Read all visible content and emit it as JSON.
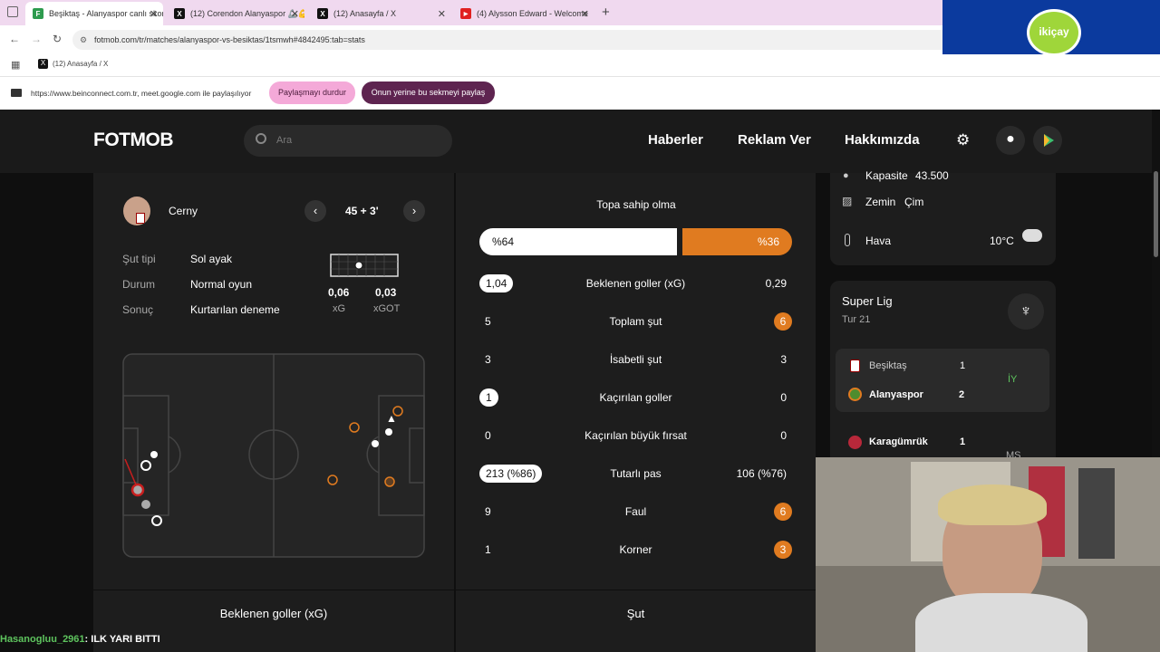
{
  "browser": {
    "tabs": [
      {
        "title": "Beşiktaş - Alanyaspor canlı skor",
        "fav": "F",
        "color": "#2d9b4e"
      },
      {
        "title": "(12) Corendon Alanyaspor 🦾💪",
        "fav": "X",
        "color": "#111"
      },
      {
        "title": "(12) Anasayfa / X",
        "fav": "X",
        "color": "#111"
      },
      {
        "title": "(4) Alysson Edward - Welcome",
        "fav": "▶",
        "color": "#e02020"
      }
    ],
    "url": "fotmob.com/tr/matches/alanyaspor-vs-besiktas/1tsmwh#4842495:tab=stats",
    "bookmark": "(12) Anasayfa / X",
    "share_text": "https://www.beinconnect.com.tr, meet.google.com ile paylaşılıyor",
    "stop_share": "Paylaşmayı durdur",
    "share_tab": "Onun yerine bu sekmeyi paylaş",
    "ad_logo": "ikiçay"
  },
  "header": {
    "logo": "FOTMOB",
    "search_placeholder": "Ara",
    "nav": [
      "Haberler",
      "Reklam Ver",
      "Hakkımızda"
    ]
  },
  "shot": {
    "player": "Cerny",
    "time": "45 + 3'",
    "rows": [
      {
        "k": "Şut tipi",
        "v": "Sol ayak"
      },
      {
        "k": "Durum",
        "v": "Normal oyun"
      },
      {
        "k": "Sonuç",
        "v": "Kurtarılan deneme"
      }
    ],
    "xg": "0,06",
    "xg_label": "xG",
    "xgot": "0,03",
    "xgot_label": "xGOT"
  },
  "stats": {
    "possession_title": "Topa sahip olma",
    "poss_home": "%64",
    "poss_away": "%36",
    "poss_home_fraction": 0.64,
    "rows": [
      {
        "l": "1,04",
        "c": "Beklenen goller (xG)",
        "r": "0,29",
        "lp": true,
        "rp": false
      },
      {
        "l": "5",
        "c": "Toplam şut",
        "r": "6",
        "lp": false,
        "rp": true
      },
      {
        "l": "3",
        "c": "İsabetli şut",
        "r": "3",
        "lp": false,
        "rp": false
      },
      {
        "l": "1",
        "c": "Kaçırılan goller",
        "r": "0",
        "lp": true,
        "rp": false
      },
      {
        "l": "0",
        "c": "Kaçırılan büyük fırsat",
        "r": "0",
        "lp": false,
        "rp": false
      },
      {
        "l": "213 (%86)",
        "c": "Tutarlı pas",
        "r": "106 (%76)",
        "lp": true,
        "rp": false
      },
      {
        "l": "9",
        "c": "Faul",
        "r": "6",
        "lp": false,
        "rp": true
      },
      {
        "l": "1",
        "c": "Korner",
        "r": "3",
        "lp": false,
        "rp": true
      }
    ]
  },
  "bottom": {
    "xg_title": "Beklenen goller (xG)",
    "shots_title": "Şut"
  },
  "venue": {
    "capacity_label": "Kapasite",
    "capacity": "43.500",
    "surface_label": "Zemin",
    "surface": "Çim",
    "weather_label": "Hava",
    "temp": "10°C"
  },
  "league": {
    "name": "Super Lig",
    "round": "Tur 21",
    "matches": [
      {
        "home": "Beşiktaş",
        "home_score": "1",
        "away": "Alanyaspor",
        "away_score": "2",
        "status": "İY"
      },
      {
        "home": "Karagümrük",
        "home_score": "1",
        "status": "MS"
      }
    ]
  },
  "chat": {
    "user": "Hasanogluu_2961",
    "message": ": ILK YARI BITTI"
  },
  "colors": {
    "accent": "#e07b20",
    "bg": "#0f0f0f",
    "panel": "#1d1d1d",
    "green": "#5ec45e"
  }
}
